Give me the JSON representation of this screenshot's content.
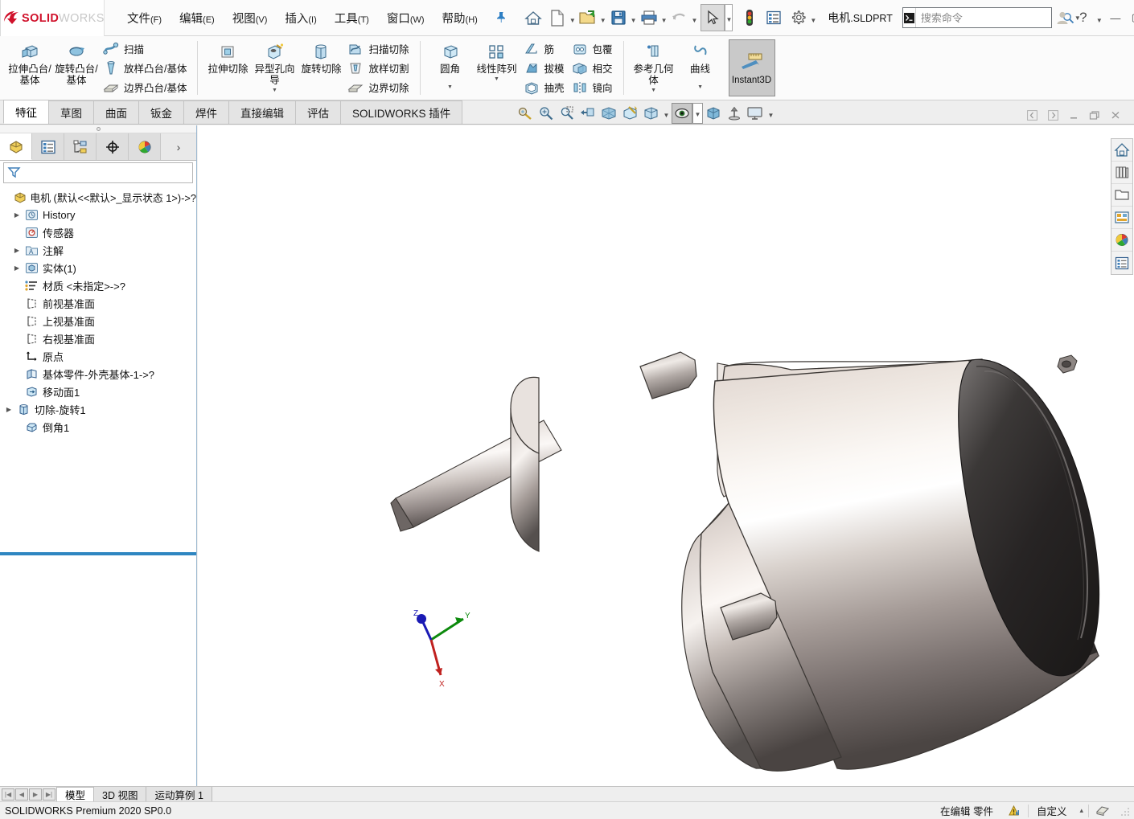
{
  "app": {
    "brand": "SOLIDWORKS",
    "document_name": "电机",
    "document_ext": ".SLDPRT",
    "version_status": "SOLIDWORKS Premium 2020 SP0.0"
  },
  "menu": {
    "items": [
      {
        "label": "文件",
        "mnemonic": "(F)",
        "name": "menu-file"
      },
      {
        "label": "编辑",
        "mnemonic": "(E)",
        "name": "menu-edit"
      },
      {
        "label": "视图",
        "mnemonic": "(V)",
        "name": "menu-view"
      },
      {
        "label": "插入",
        "mnemonic": "(I)",
        "name": "menu-insert"
      },
      {
        "label": "工具",
        "mnemonic": "(T)",
        "name": "menu-tools"
      },
      {
        "label": "窗口",
        "mnemonic": "(W)",
        "name": "menu-window"
      },
      {
        "label": "帮助",
        "mnemonic": "(H)",
        "name": "menu-help"
      }
    ]
  },
  "quick_access": {
    "buttons": [
      {
        "icon": "home-icon",
        "name": "home-button"
      },
      {
        "icon": "new-document-icon",
        "name": "new-document-button",
        "has_caret": true
      },
      {
        "icon": "open-folder-icon",
        "name": "open-document-button",
        "has_caret": true
      },
      {
        "icon": "save-floppy-icon",
        "name": "save-button",
        "has_caret": true
      },
      {
        "icon": "printer-icon",
        "name": "print-button",
        "has_caret": true
      },
      {
        "icon": "undo-arrow-icon",
        "name": "undo-button",
        "has_caret": true
      },
      {
        "icon": "select-cursor-icon",
        "name": "select-button",
        "has_caret": true,
        "selected": true
      },
      {
        "icon": "traffic-light-icon",
        "name": "rebuild-button"
      },
      {
        "icon": "options-list-icon",
        "name": "file-properties-button"
      },
      {
        "icon": "gear-icon",
        "name": "options-button",
        "has_caret": true
      }
    ]
  },
  "search": {
    "placeholder": "搜索命令",
    "value": ""
  },
  "window_controls": {
    "account": "account-icon",
    "help": "?",
    "help_caret": "▾",
    "minimize": "—",
    "maximize": "▢",
    "close": "✕"
  },
  "ribbon": {
    "groups": [
      {
        "name": "boss-base-group",
        "big": [
          {
            "label": "拉伸凸台/基体",
            "icon": "extrude-boss-icon",
            "name": "extruded-boss-base"
          },
          {
            "label": "旋转凸台/基体",
            "icon": "revolve-boss-icon",
            "name": "revolved-boss-base"
          }
        ],
        "small": [
          {
            "label": "扫描",
            "icon": "sweep-icon",
            "name": "swept-boss-base"
          },
          {
            "label": "放样凸台/基体",
            "icon": "loft-icon",
            "name": "lofted-boss-base"
          },
          {
            "label": "边界凸台/基体",
            "icon": "boundary-icon",
            "name": "boundary-boss-base"
          }
        ]
      },
      {
        "name": "cut-group",
        "big": [
          {
            "label": "拉伸切除",
            "icon": "extrude-cut-icon",
            "name": "extruded-cut"
          },
          {
            "label": "异型孔向导",
            "icon": "hole-wizard-icon",
            "name": "hole-wizard",
            "has_dropdown": true
          },
          {
            "label": "旋转切除",
            "icon": "revolve-cut-icon",
            "name": "revolved-cut"
          }
        ],
        "small": [
          {
            "label": "扫描切除",
            "icon": "swept-cut-icon",
            "name": "swept-cut"
          },
          {
            "label": "放样切割",
            "icon": "lofted-cut-icon",
            "name": "lofted-cut"
          },
          {
            "label": "边界切除",
            "icon": "boundary-cut-icon",
            "name": "boundary-cut"
          }
        ]
      },
      {
        "name": "feature-group",
        "big": [
          {
            "label": "圆角",
            "icon": "fillet-icon",
            "name": "fillet",
            "has_dropdown": true
          },
          {
            "label": "线性阵列",
            "icon": "linear-pattern-icon",
            "name": "linear-pattern",
            "has_dropdown": true
          }
        ],
        "small": [
          {
            "label": "筋",
            "icon": "rib-icon",
            "name": "rib"
          },
          {
            "label": "拔模",
            "icon": "draft-icon",
            "name": "draft"
          },
          {
            "label": "抽壳",
            "icon": "shell-icon",
            "name": "shell"
          }
        ],
        "small2": [
          {
            "label": "包覆",
            "icon": "wrap-icon",
            "name": "wrap"
          },
          {
            "label": "相交",
            "icon": "intersect-icon",
            "name": "intersect"
          },
          {
            "label": "镜向",
            "icon": "mirror-icon",
            "name": "mirror"
          }
        ]
      },
      {
        "name": "reference-group",
        "big": [
          {
            "label": "参考几何体",
            "icon": "reference-geometry-icon",
            "name": "reference-geometry",
            "has_dropdown": true
          },
          {
            "label": "曲线",
            "icon": "curves-icon",
            "name": "curves",
            "has_dropdown": true
          }
        ]
      }
    ],
    "instant3d": {
      "label": "Instant3D",
      "icon": "instant3d-icon",
      "name": "instant3d-toggle",
      "active": true
    }
  },
  "command_tabs": [
    {
      "label": "特征",
      "name": "tab-features",
      "active": true
    },
    {
      "label": "草图",
      "name": "tab-sketch",
      "active": false
    },
    {
      "label": "曲面",
      "name": "tab-surfaces",
      "active": false
    },
    {
      "label": "钣金",
      "name": "tab-sheetmetal",
      "active": false
    },
    {
      "label": "焊件",
      "name": "tab-weldments",
      "active": false
    },
    {
      "label": "直接编辑",
      "name": "tab-direct-editing",
      "active": false
    },
    {
      "label": "评估",
      "name": "tab-evaluate",
      "active": false
    },
    {
      "label": "SOLIDWORKS 插件",
      "name": "tab-solidworks-addins",
      "active": false
    }
  ],
  "view_toolbar": [
    {
      "icon": "zoom-to-fit-icon",
      "name": "zoom-to-fit-button"
    },
    {
      "icon": "zoom-to-area-icon",
      "name": "zoom-to-area-button"
    },
    {
      "icon": "previous-view-icon",
      "name": "previous-view-button"
    },
    {
      "icon": "section-view-icon",
      "name": "section-view-button"
    },
    {
      "icon": "view-orientation-icon",
      "name": "view-orientation-button"
    },
    {
      "icon": "display-style-icon",
      "name": "display-style-button",
      "has_caret": true
    },
    {
      "icon": "hide-show-icon",
      "name": "hide-show-items-button",
      "has_caret": true
    },
    {
      "icon": "appearance-icon",
      "name": "edit-appearance-button",
      "selected": true,
      "has_caret": true
    },
    {
      "icon": "apply-scene-icon",
      "name": "apply-scene-button"
    },
    {
      "icon": "view-settings-icon",
      "name": "view-settings-button"
    },
    {
      "icon": "display-screen-icon",
      "name": "full-screen-button",
      "has_caret": true
    }
  ],
  "document_window_buttons": [
    {
      "icon": "prev-doc-icon",
      "name": "previous-document-button"
    },
    {
      "icon": "next-doc-icon",
      "name": "next-document-button"
    },
    {
      "icon": "minimize-doc-icon",
      "name": "minimize-document-button"
    },
    {
      "icon": "restore-doc-icon",
      "name": "restore-document-button"
    },
    {
      "icon": "close-doc-icon",
      "name": "close-document-button"
    }
  ],
  "feature_manager": {
    "tabs": [
      {
        "icon": "feature-tree-icon",
        "name": "fmtab-feature-tree",
        "active": true
      },
      {
        "icon": "property-manager-icon",
        "name": "fmtab-property-manager",
        "active": false
      },
      {
        "icon": "configuration-manager-icon",
        "name": "fmtab-configuration-manager",
        "active": false
      },
      {
        "icon": "dimxpert-icon",
        "name": "fmtab-dimxpert-manager",
        "active": false
      },
      {
        "icon": "display-manager-icon",
        "name": "fmtab-display-manager",
        "active": false
      }
    ],
    "more_glyph": "›",
    "filter": {
      "placeholder": "",
      "value": "",
      "icon": "filter-funnel-icon"
    },
    "root": {
      "label": "电机  (默认<<默认>_显示状态 1>)->?",
      "icon": "part-root-icon"
    },
    "nodes": [
      {
        "label": "History",
        "icon": "history-icon",
        "expandable": true,
        "indent": 1
      },
      {
        "label": "传感器",
        "icon": "sensors-icon",
        "expandable": false,
        "indent": 1
      },
      {
        "label": "注解",
        "icon": "annotations-icon",
        "expandable": true,
        "indent": 1
      },
      {
        "label": "实体(1)",
        "icon": "solid-bodies-icon",
        "expandable": true,
        "indent": 1
      },
      {
        "label": "材质 <未指定>->?",
        "icon": "material-icon",
        "expandable": false,
        "indent": 1
      },
      {
        "label": "前视基准面",
        "icon": "plane-icon",
        "expandable": false,
        "indent": 1
      },
      {
        "label": "上视基准面",
        "icon": "plane-icon",
        "expandable": false,
        "indent": 1
      },
      {
        "label": "右视基准面",
        "icon": "plane-icon",
        "expandable": false,
        "indent": 1
      },
      {
        "label": "原点",
        "icon": "origin-icon",
        "expandable": false,
        "indent": 1
      },
      {
        "label": "基体零件-外壳基体-1->?",
        "icon": "base-part-icon",
        "expandable": false,
        "indent": 1
      },
      {
        "label": "移动面1",
        "icon": "move-face-icon",
        "expandable": false,
        "indent": 1
      },
      {
        "label": "切除-旋转1",
        "icon": "revolve-cut-tree-icon",
        "expandable": true,
        "indent": 1
      },
      {
        "label": "倒角1",
        "icon": "chamfer-icon",
        "expandable": false,
        "indent": 1
      }
    ]
  },
  "right_toolbar": [
    {
      "icon": "home-view-icon",
      "name": "task-pane-resources"
    },
    {
      "icon": "design-library-icon",
      "name": "task-pane-design-library"
    },
    {
      "icon": "file-explorer-icon",
      "name": "task-pane-file-explorer"
    },
    {
      "icon": "view-palette-icon",
      "name": "task-pane-view-palette"
    },
    {
      "icon": "appearances-scenes-icon",
      "name": "task-pane-appearances-scenes"
    },
    {
      "icon": "custom-properties-icon",
      "name": "task-pane-custom-properties"
    }
  ],
  "triad": {
    "x_label": "X",
    "y_label": "Y",
    "z_label": "Z",
    "colors": {
      "x": "#cc0000",
      "y": "#008000",
      "z": "#0000cc"
    }
  },
  "document_tabs": {
    "nav": [
      "◀◀",
      "◀",
      "▶",
      "▶▶"
    ],
    "tabs": [
      {
        "label": "模型",
        "name": "doc-tab-model",
        "active": true
      },
      {
        "label": "3D 视图",
        "name": "doc-tab-3dviews",
        "active": false
      },
      {
        "label": "运动算例 1",
        "name": "doc-tab-motion-study",
        "active": false
      }
    ]
  },
  "status_bar": {
    "left": "SOLIDWORKS Premium 2020 SP0.0",
    "editing": "在编辑 零件",
    "rebuild_icon": "rebuild-warning-icon",
    "custom": "自定义",
    "custom_caret": "▴",
    "overlay_icon": "overlay-icon"
  },
  "colors": {
    "brand_red": "#d0112b",
    "accent_blue": "#2e86c1",
    "ribbon_bg": "#fbfbfb",
    "panel_bg": "#ffffff",
    "graphics_bg": "#ffffff",
    "tab_inactive": "#e4e4e4"
  },
  "model": {
    "name": "电机",
    "description": "motor-body-3d-model"
  }
}
